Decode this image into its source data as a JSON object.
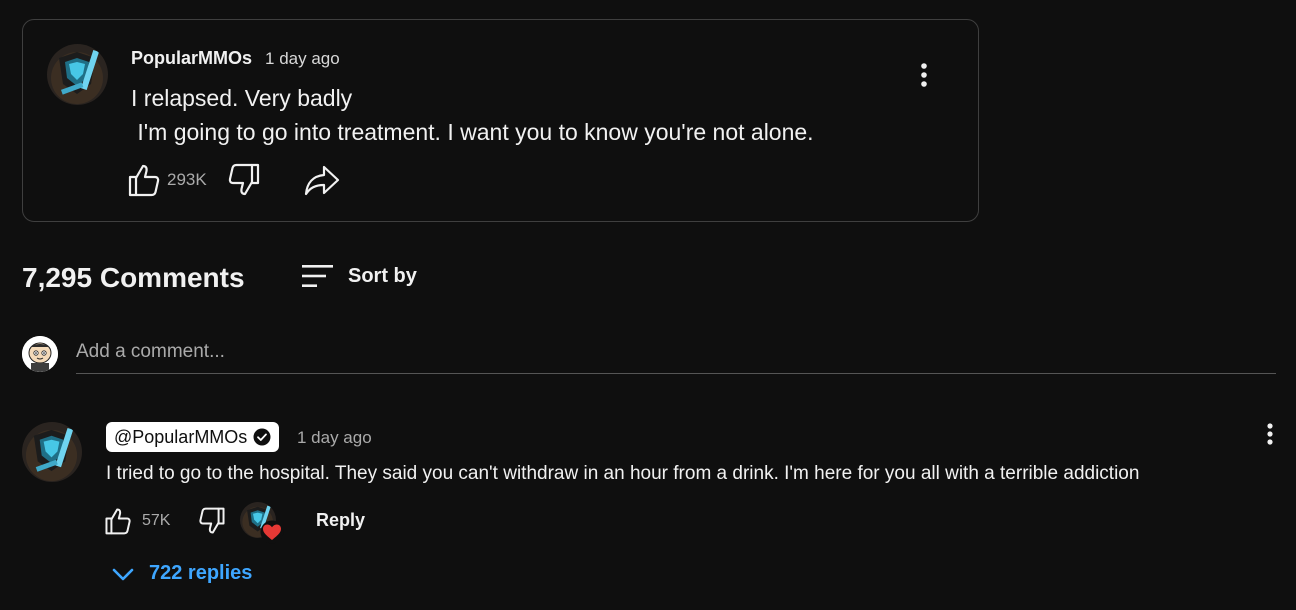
{
  "colors": {
    "background": "#0f0f0f",
    "text": "#f1f1f1",
    "muted": "#aaaaaa",
    "link": "#3ea6ff",
    "card_border": "#3f3f3f",
    "heart": "#e53935"
  },
  "post": {
    "author": "PopularMMOs",
    "time": "1 day ago",
    "body": "I relapsed. Very badly\n I'm going to go into treatment. I want you to know you're not alone.",
    "like_count": "293K",
    "icons": {
      "avatar": "channel-avatar-icon",
      "menu": "more-vert-icon",
      "like": "thumb-up-icon",
      "dislike": "thumb-down-icon",
      "share": "share-icon"
    }
  },
  "comments_section": {
    "count_label": "7,295 Comments",
    "sort_label": "Sort by",
    "add_comment_placeholder": "Add a comment..."
  },
  "top_comment": {
    "author": "@PopularMMOs",
    "verified": true,
    "time": "1 day ago",
    "text": "I tried to go to the hospital. They said you can't withdraw in an hour from a drink. I'm here for you all with a terrible addiction",
    "like_count": "57K",
    "reply_label": "Reply",
    "replies_label": "722 replies",
    "creator_heart": true
  }
}
